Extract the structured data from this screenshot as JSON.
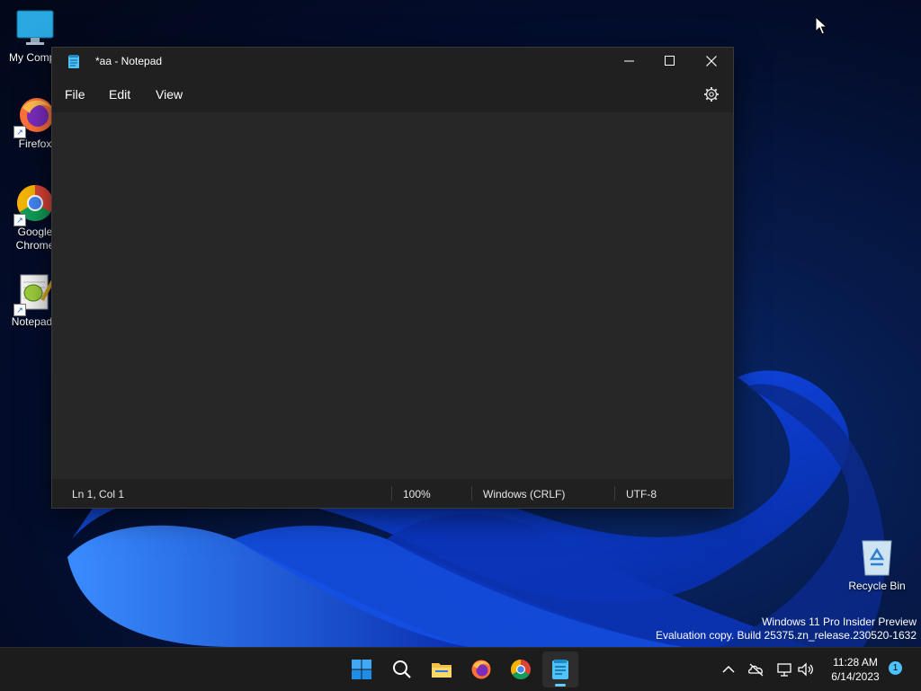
{
  "desktop": {
    "icons": [
      {
        "label": "My Compu"
      },
      {
        "label": "Firefox"
      },
      {
        "label": "Google Chrome"
      },
      {
        "label": "Notepad+"
      },
      {
        "label": "Recycle Bin"
      }
    ],
    "watermark_line1": "Windows 11 Pro Insider Preview",
    "watermark_line2": "Evaluation copy. Build 25375.zn_release.230520-1632"
  },
  "window": {
    "title": "*aa - Notepad",
    "menu": {
      "file": "File",
      "edit": "Edit",
      "view": "View"
    },
    "editor_content": "",
    "status": {
      "position": "Ln 1, Col 1",
      "zoom": "100%",
      "line_ending": "Windows (CRLF)",
      "encoding": "UTF-8"
    }
  },
  "taskbar": {
    "apps": [
      "start",
      "search",
      "file-explorer",
      "firefox",
      "chrome",
      "notepad"
    ],
    "active_app": "notepad",
    "clock_time": "11:28 AM",
    "clock_date": "6/14/2023",
    "notification_count": "1"
  },
  "colors": {
    "window_bg": "#202020",
    "editor_bg": "#272727",
    "taskbar_bg": "#1c1c1c",
    "accent": "#60cdff"
  }
}
